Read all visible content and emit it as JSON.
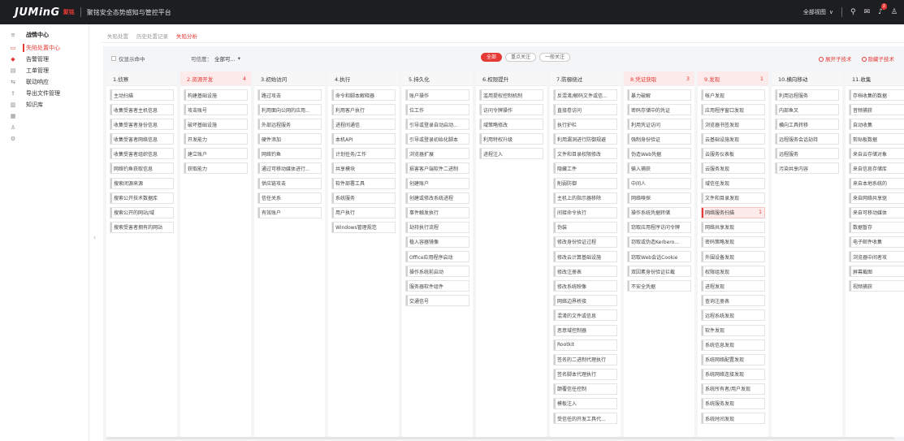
{
  "header": {
    "logo": "JUMinG",
    "logo_sub": "聚铭",
    "platform_title": "聚铭安全态势感知与管控平台",
    "region_select": "全部视图",
    "notification_count": "2"
  },
  "sidebar": {
    "items": [
      {
        "label": "战情中心",
        "icon": "menu-icon",
        "kind": "head"
      },
      {
        "label": "失陷处置中心",
        "icon": "monitor-icon",
        "kind": "active"
      },
      {
        "label": "告警管理",
        "icon": "alert-icon",
        "kind": "sub"
      },
      {
        "label": "工单管理",
        "icon": "ticket-icon",
        "kind": "sub"
      },
      {
        "label": "联动响应",
        "icon": "link-icon",
        "kind": "sub"
      },
      {
        "label": "导出文件管理",
        "icon": "export-icon",
        "kind": "sub"
      },
      {
        "label": "知识库",
        "icon": "book-icon",
        "kind": "sub"
      }
    ],
    "extra_icons": [
      "list-icon",
      "user-icon",
      "settings-icon"
    ]
  },
  "subtabs": [
    "失陷处置",
    "历史处置记录",
    "失陷分析"
  ],
  "active_subtab": 2,
  "filters": {
    "only_hits_label": "仅显示命中",
    "confidence_label": "可信度：",
    "confidence_value": "全部可...",
    "pills": [
      "全部",
      "重点关注",
      "一般关注"
    ],
    "active_pill": 0,
    "expand_label": "展开子技术",
    "collapse_label": "隐藏子技术"
  },
  "colors": {
    "accent": "#e53935",
    "topbar": "#1d1e22",
    "panel": "#f4f5f7"
  },
  "tactics": [
    {
      "name": "1.侦察",
      "count": "",
      "items": [
        {
          "t": "主动扫描"
        },
        {
          "t": "收集受害者主机信息"
        },
        {
          "t": "收集受害者身份信息"
        },
        {
          "t": "收集受害者网络信息"
        },
        {
          "t": "收集受害者组织信息"
        },
        {
          "t": "网络钓鱼获取信息"
        },
        {
          "t": "搜索闭源来源"
        },
        {
          "t": "搜索公开技术数据库"
        },
        {
          "t": "搜索公开的网站/域"
        },
        {
          "t": "搜索受害者拥有的网站"
        }
      ]
    },
    {
      "name": "2.资源开发",
      "count": "4",
      "items": [
        {
          "t": "构建基础设施"
        },
        {
          "t": "攻击账号"
        },
        {
          "t": "破坏基础设施"
        },
        {
          "t": "开发能力"
        },
        {
          "t": "建立账户"
        },
        {
          "t": "获取能力"
        }
      ]
    },
    {
      "name": "3.初始访问",
      "count": "",
      "items": [
        {
          "t": "路过攻击"
        },
        {
          "t": "利用面向公网的应用..."
        },
        {
          "t": "外部远程服务"
        },
        {
          "t": "硬件添加"
        },
        {
          "t": "网络钓鱼"
        },
        {
          "t": "通过可移动媒体进行..."
        },
        {
          "t": "供应链攻击"
        },
        {
          "t": "信任关系"
        },
        {
          "t": "有效账户"
        }
      ]
    },
    {
      "name": "4.执行",
      "count": "",
      "items": [
        {
          "t": "命令和脚本解释器"
        },
        {
          "t": "利用客户执行"
        },
        {
          "t": "进程间通信"
        },
        {
          "t": "本机API"
        },
        {
          "t": "计划任务/工作"
        },
        {
          "t": "共享模块"
        },
        {
          "t": "软件部署工具"
        },
        {
          "t": "系统服务"
        },
        {
          "t": "用户执行"
        },
        {
          "t": "Windows管理规范"
        }
      ]
    },
    {
      "name": "5.持久化",
      "count": "",
      "items": [
        {
          "t": "账户操作"
        },
        {
          "t": "位工作"
        },
        {
          "t": "引导或登录自动启动..."
        },
        {
          "t": "引导或登录初始化脚本"
        },
        {
          "t": "浏览器扩展"
        },
        {
          "t": "损害客户端软件二进制"
        },
        {
          "t": "创建账户"
        },
        {
          "t": "创建或修改系统进程"
        },
        {
          "t": "事件触发执行"
        },
        {
          "t": "劫持执行流程"
        },
        {
          "t": "植入容器镜像"
        },
        {
          "t": "Office应用程序启动"
        },
        {
          "t": "操作系统前启动"
        },
        {
          "t": "服务器软件组件"
        },
        {
          "t": "交通信号"
        }
      ]
    },
    {
      "name": "6.权限提升",
      "count": "",
      "items": [
        {
          "t": "滥用提权控制机制"
        },
        {
          "t": "访问令牌操作"
        },
        {
          "t": "域策略修改"
        },
        {
          "t": "利用特权升级"
        },
        {
          "t": "进程注入"
        }
      ]
    },
    {
      "name": "7.防御绕过",
      "count": "",
      "items": [
        {
          "t": "反混淆/解码文件或信..."
        },
        {
          "t": "直接卷访问"
        },
        {
          "t": "执行护栏"
        },
        {
          "t": "利用漏洞进行防御规避"
        },
        {
          "t": "文件和目录权限修改"
        },
        {
          "t": "隐藏工件"
        },
        {
          "t": "削弱防御"
        },
        {
          "t": "主机上的指示器移除"
        },
        {
          "t": "间接命令执行"
        },
        {
          "t": "伪装"
        },
        {
          "t": "修改身份验证过程"
        },
        {
          "t": "修改云计算基础设施"
        },
        {
          "t": "修改注册表"
        },
        {
          "t": "修改系统映像"
        },
        {
          "t": "网络边界桥接"
        },
        {
          "t": "混淆的文件或信息"
        },
        {
          "t": "恶意域控制器"
        },
        {
          "t": "Rootkit"
        },
        {
          "t": "签名的二进制代理执行"
        },
        {
          "t": "签名脚本代理执行"
        },
        {
          "t": "颠覆信任控制"
        },
        {
          "t": "模板注入"
        },
        {
          "t": "受信任的开发工具代..."
        }
      ]
    },
    {
      "name": "8.凭证获取",
      "count": "3",
      "items": [
        {
          "t": "暴力破解"
        },
        {
          "t": "密码存储中的凭证"
        },
        {
          "t": "利用凭证访问"
        },
        {
          "t": "强制身份验证"
        },
        {
          "t": "伪造Web凭据"
        },
        {
          "t": "输入捕获"
        },
        {
          "t": "中间人"
        },
        {
          "t": "网络嗅探"
        },
        {
          "t": "操作系统凭据转储"
        },
        {
          "t": "窃取应用程序访问令牌"
        },
        {
          "t": "窃取或伪造Kerbero..."
        },
        {
          "t": "窃取Web会话Cookie"
        },
        {
          "t": "双因素身份验证拦截"
        },
        {
          "t": "不安全凭据"
        }
      ]
    },
    {
      "name": "9.发现",
      "count": "1",
      "items": [
        {
          "t": "帐户发现"
        },
        {
          "t": "应用程序窗口发现"
        },
        {
          "t": "浏览器书签发现"
        },
        {
          "t": "云基础设施发现"
        },
        {
          "t": "云服务仪表板"
        },
        {
          "t": "云服务发现"
        },
        {
          "t": "域信任发现"
        },
        {
          "t": "文件和目录发现"
        },
        {
          "t": "网络服务扫描",
          "c": "1"
        },
        {
          "t": "网络共享发现"
        },
        {
          "t": "密码策略发现"
        },
        {
          "t": "外围设备发现"
        },
        {
          "t": "权限组发现"
        },
        {
          "t": "进程发现"
        },
        {
          "t": "查询注册表"
        },
        {
          "t": "远程系统发现"
        },
        {
          "t": "软件发现"
        },
        {
          "t": "系统信息发现"
        },
        {
          "t": "系统网络配置发现"
        },
        {
          "t": "系统网络连接发现"
        },
        {
          "t": "系统所有者/用户发现"
        },
        {
          "t": "系统服务发现"
        },
        {
          "t": "系统时间发现"
        }
      ]
    },
    {
      "name": "10.横向移动",
      "count": "",
      "items": [
        {
          "t": "利用远程服务"
        },
        {
          "t": "内部鱼叉"
        },
        {
          "t": "横向工具转移"
        },
        {
          "t": "远程服务会话劫持"
        },
        {
          "t": "远程服务"
        },
        {
          "t": "污染共享内容"
        }
      ]
    },
    {
      "name": "11.收集",
      "count": "",
      "items": [
        {
          "t": "存档收集的数据"
        },
        {
          "t": "音频捕获"
        },
        {
          "t": "自动收集"
        },
        {
          "t": "剪贴板数据"
        },
        {
          "t": "来自云存储对象"
        },
        {
          "t": "来自信息存储库"
        },
        {
          "t": "来自本地系统的"
        },
        {
          "t": "来自网络共享驱"
        },
        {
          "t": "来自可移动媒体"
        },
        {
          "t": "数据暂存"
        },
        {
          "t": "电子邮件收集"
        },
        {
          "t": "浏览器中间者攻"
        },
        {
          "t": "屏幕截图"
        },
        {
          "t": "视频捕获"
        }
      ]
    }
  ]
}
